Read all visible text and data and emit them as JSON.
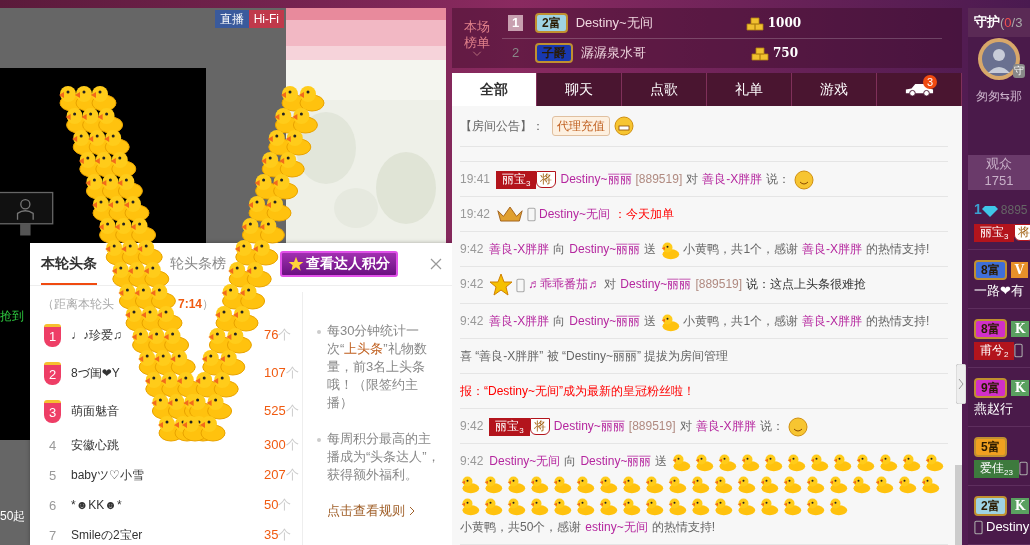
{
  "stage": {
    "badges": [
      {
        "text": "直播",
        "color": "#3a5a9c"
      },
      {
        "text": "Hi-Fi",
        "color": "#c0394b"
      }
    ],
    "side_texts": [
      {
        "text": "抢到",
        "kind": "green"
      },
      {
        "text": "50起",
        "kind": "white"
      }
    ]
  },
  "popup": {
    "tabs": [
      {
        "label": "本轮头条",
        "selected": true
      },
      {
        "label": "轮头条榜",
        "selected": false
      }
    ],
    "score_button": "查看达人积分",
    "countdown": {
      "prefix": "（距离本轮头",
      "time": "7:14",
      "suffix": "）"
    },
    "rows": [
      {
        "rank": "1",
        "kind": "medal",
        "name": "♩♪珍爱♫",
        "count": "76",
        "unit": "个"
      },
      {
        "rank": "2",
        "kind": "medal",
        "name": "8づ闺❤Y",
        "count": "107",
        "unit": "个"
      },
      {
        "rank": "3",
        "kind": "medal",
        "name": "萌面魅音",
        "count": "525",
        "unit": "个"
      },
      {
        "rank": "4",
        "kind": "plain",
        "name": "安徽心跳",
        "count": "300",
        "unit": "个"
      },
      {
        "rank": "5",
        "kind": "plain",
        "name": "babyツ♡小雪",
        "count": "207",
        "unit": "个"
      },
      {
        "rank": "6",
        "kind": "plain",
        "name": "*☻KK☻*",
        "count": "50",
        "unit": "个"
      },
      {
        "rank": "7",
        "kind": "plain",
        "name": "Smileの2宝er",
        "count": "35",
        "unit": "个"
      }
    ],
    "notes": [
      [
        {
          "text": "每30分钟统计一次“"
        },
        {
          "text": "上头条",
          "highlight": true
        },
        {
          "text": "”礼物数量，前3名上头条哦！（限签约主播）"
        }
      ],
      [
        {
          "text": "每周积分最高的主播成为“头条达人”，获得额外福利。"
        }
      ]
    ],
    "rule_link": "点击查看规则"
  },
  "ranking": {
    "label": "本场榜单",
    "rows": [
      {
        "rank": "1",
        "kind": "top",
        "badge": {
          "text": "2富",
          "color": "#9fd3e3"
        },
        "name": "Destiny~无间",
        "score": "1000"
      },
      {
        "rank": "2",
        "kind": "plain",
        "badge": {
          "text": "子爵",
          "color": "#1838b0"
        },
        "name": "潺潺泉水哥",
        "score": "750"
      }
    ]
  },
  "tabs": [
    {
      "label": "全部",
      "kind": "text",
      "selected": true
    },
    {
      "label": "聊天",
      "kind": "text",
      "selected": false
    },
    {
      "label": "点歌",
      "kind": "text",
      "selected": false
    },
    {
      "label": "礼单",
      "kind": "text",
      "selected": false
    },
    {
      "label": "游戏",
      "kind": "text",
      "selected": false
    },
    {
      "kind": "car",
      "count": "3",
      "selected": false
    }
  ],
  "notice": {
    "label": "【房间公告】：",
    "tag": "代理充值"
  },
  "messages": [
    {
      "time": "19:41",
      "parts": [
        {
          "kind": "badge",
          "text": "丽宝",
          "sub": "3",
          "color": "#b3141c"
        },
        {
          "kind": "shield",
          "text": "将"
        },
        {
          "kind": "name",
          "text": "Destiny~丽丽"
        },
        {
          "kind": "id",
          "text": "[889519]"
        },
        {
          "kind": "text",
          "text": "对"
        },
        {
          "kind": "name",
          "text": "善良-X胖胖"
        },
        {
          "kind": "text",
          "text": "说："
        },
        {
          "kind": "emoji"
        }
      ]
    },
    {
      "time": "19:42",
      "parts": [
        {
          "kind": "crown"
        },
        {
          "kind": "phone"
        },
        {
          "kind": "name",
          "text": "Destiny~无间"
        },
        {
          "kind": "red",
          "text": "：今天加单"
        }
      ]
    },
    {
      "time": "9:42",
      "parts": [
        {
          "kind": "name",
          "text": "善良-X胖胖"
        },
        {
          "kind": "text",
          "text": "向"
        },
        {
          "kind": "name",
          "text": "Destiny~丽丽"
        },
        {
          "kind": "text",
          "text": "送"
        },
        {
          "kind": "duck"
        },
        {
          "kind": "text",
          "text": "小黄鸭，共1个，感谢"
        },
        {
          "kind": "name",
          "text": "善良-X胖胖"
        },
        {
          "kind": "text",
          "text": "的热情支持!"
        }
      ]
    },
    {
      "time": "9:42",
      "parts": [
        {
          "kind": "star"
        },
        {
          "kind": "phone"
        },
        {
          "kind": "name",
          "text": "♬乖乖番茄♬"
        },
        {
          "kind": "text",
          "text": "对"
        },
        {
          "kind": "name",
          "text": "Destiny~丽丽"
        },
        {
          "kind": "id",
          "text": "[889519]"
        },
        {
          "kind": "dark",
          "text": "说：这点上头条很难抢"
        }
      ]
    },
    {
      "time": "9:42",
      "parts": [
        {
          "kind": "name",
          "text": "善良-X胖胖"
        },
        {
          "kind": "text",
          "text": "向"
        },
        {
          "kind": "name",
          "text": "Destiny~丽丽"
        },
        {
          "kind": "text",
          "text": "送"
        },
        {
          "kind": "duck"
        },
        {
          "kind": "text",
          "text": "小黄鸭，共1个，感谢"
        },
        {
          "kind": "name",
          "text": "善良-X胖胖"
        },
        {
          "kind": "text",
          "text": "的热情支持!"
        }
      ]
    },
    {
      "parts": [
        {
          "kind": "text",
          "text": "喜 “善良-X胖胖” 被 “Destiny~丽丽” 提拔为房间管理"
        }
      ]
    },
    {
      "parts": [
        {
          "kind": "red",
          "text": "报：“Destiny~无间”成为最新的皇冠粉丝啦！"
        }
      ]
    },
    {
      "time": "9:42",
      "parts": [
        {
          "kind": "badge",
          "text": "丽宝",
          "sub": "3",
          "color": "#b3141c"
        },
        {
          "kind": "shield",
          "text": "将"
        },
        {
          "kind": "name",
          "text": "Destiny~丽丽"
        },
        {
          "kind": "id",
          "text": "[889519]"
        },
        {
          "kind": "text",
          "text": "对"
        },
        {
          "kind": "name",
          "text": "善良-X胖胖"
        },
        {
          "kind": "text",
          "text": "说："
        },
        {
          "kind": "emoji"
        }
      ]
    },
    {
      "time": "9:42",
      "parts": [
        {
          "kind": "name",
          "text": "Destiny~无间"
        },
        {
          "kind": "text",
          "text": "向"
        },
        {
          "kind": "name",
          "text": "Destiny~丽丽"
        },
        {
          "kind": "text",
          "text": "送"
        },
        {
          "kind": "duck"
        },
        {
          "kind": "duck"
        },
        {
          "kind": "duck"
        },
        {
          "kind": "duck"
        },
        {
          "kind": "duck"
        },
        {
          "kind": "duck"
        },
        {
          "kind": "duck"
        },
        {
          "kind": "duck"
        },
        {
          "kind": "duck"
        },
        {
          "kind": "duck"
        },
        {
          "kind": "duck"
        },
        {
          "kind": "duck"
        },
        {
          "kind": "duck"
        },
        {
          "kind": "duck"
        },
        {
          "kind": "duck"
        },
        {
          "kind": "duck"
        },
        {
          "kind": "duck"
        },
        {
          "kind": "duck"
        },
        {
          "kind": "duck"
        },
        {
          "kind": "duck"
        },
        {
          "kind": "duck"
        },
        {
          "kind": "duck"
        },
        {
          "kind": "duck"
        },
        {
          "kind": "duck"
        },
        {
          "kind": "duck"
        },
        {
          "kind": "duck"
        },
        {
          "kind": "duck"
        },
        {
          "kind": "duck"
        },
        {
          "kind": "duck"
        },
        {
          "kind": "duck"
        },
        {
          "kind": "duck"
        },
        {
          "kind": "duck"
        },
        {
          "kind": "duck"
        },
        {
          "kind": "duck"
        },
        {
          "kind": "duck"
        },
        {
          "kind": "duck"
        },
        {
          "kind": "duck"
        },
        {
          "kind": "duck"
        },
        {
          "kind": "duck"
        },
        {
          "kind": "duck"
        },
        {
          "kind": "duck"
        },
        {
          "kind": "duck"
        },
        {
          "kind": "duck"
        },
        {
          "kind": "duck"
        },
        {
          "kind": "duck"
        },
        {
          "kind": "duck"
        },
        {
          "kind": "duck"
        },
        {
          "kind": "duck"
        },
        {
          "kind": "duck"
        },
        {
          "kind": "duck"
        },
        {
          "kind": "text",
          "text": "小黄鸭，共50个，感谢"
        },
        {
          "kind": "name",
          "text": "estiny~无间"
        },
        {
          "kind": "text",
          "text": "的热情支持!"
        }
      ]
    }
  ],
  "sidebar": {
    "guard": {
      "label": "守护",
      "open": "(",
      "filled": "0",
      "total": "/3"
    },
    "guard_name": "匆匆⇆那",
    "guard_tag": "守",
    "audience": {
      "label": "观众",
      "count": "1751"
    },
    "users": [
      [
        [
          {
            "kind": "rank",
            "text": "1"
          },
          {
            "kind": "diamond"
          },
          {
            "kind": "text",
            "text": "8895"
          }
        ],
        [
          {
            "kind": "badge",
            "text": "丽宝",
            "sub": "3",
            "color": "#b3141c"
          },
          {
            "kind": "shield",
            "text": "将"
          }
        ]
      ],
      [
        [
          {
            "kind": "wealth",
            "text": "8富",
            "color": "#3f6fd8"
          },
          {
            "kind": "level",
            "text": "V",
            "color": "#e8902a"
          }
        ],
        [
          {
            "kind": "white",
            "text": "一路❤有"
          }
        ]
      ],
      [
        [
          {
            "kind": "wealth",
            "text": "8富",
            "color": "#d12fc8"
          },
          {
            "kind": "level",
            "text": "K",
            "color": "#5aa060"
          }
        ],
        [
          {
            "kind": "badge",
            "text": "甫兮",
            "sub": "2",
            "color": "#b3141c"
          },
          {
            "kind": "phone"
          }
        ]
      ],
      [
        [
          {
            "kind": "wealth",
            "text": "9富",
            "color": "#d12fc8"
          },
          {
            "kind": "level",
            "text": "K",
            "color": "#5aa060"
          }
        ],
        [
          {
            "kind": "white",
            "text": "燕赵行"
          }
        ]
      ],
      [
        [
          {
            "kind": "wealth",
            "text": "5富",
            "color": "#f0a020"
          }
        ],
        [
          {
            "kind": "badge",
            "text": "爱佳",
            "sub": "23",
            "color": "#3d7a3d"
          },
          {
            "kind": "phone"
          }
        ]
      ],
      [
        [
          {
            "kind": "wealth",
            "text": "2富",
            "color": "#9fd3e3"
          },
          {
            "kind": "level",
            "text": "K",
            "color": "#5aa060"
          }
        ],
        [
          {
            "kind": "phone"
          },
          {
            "kind": "white",
            "text": "Destiny"
          }
        ]
      ]
    ]
  }
}
